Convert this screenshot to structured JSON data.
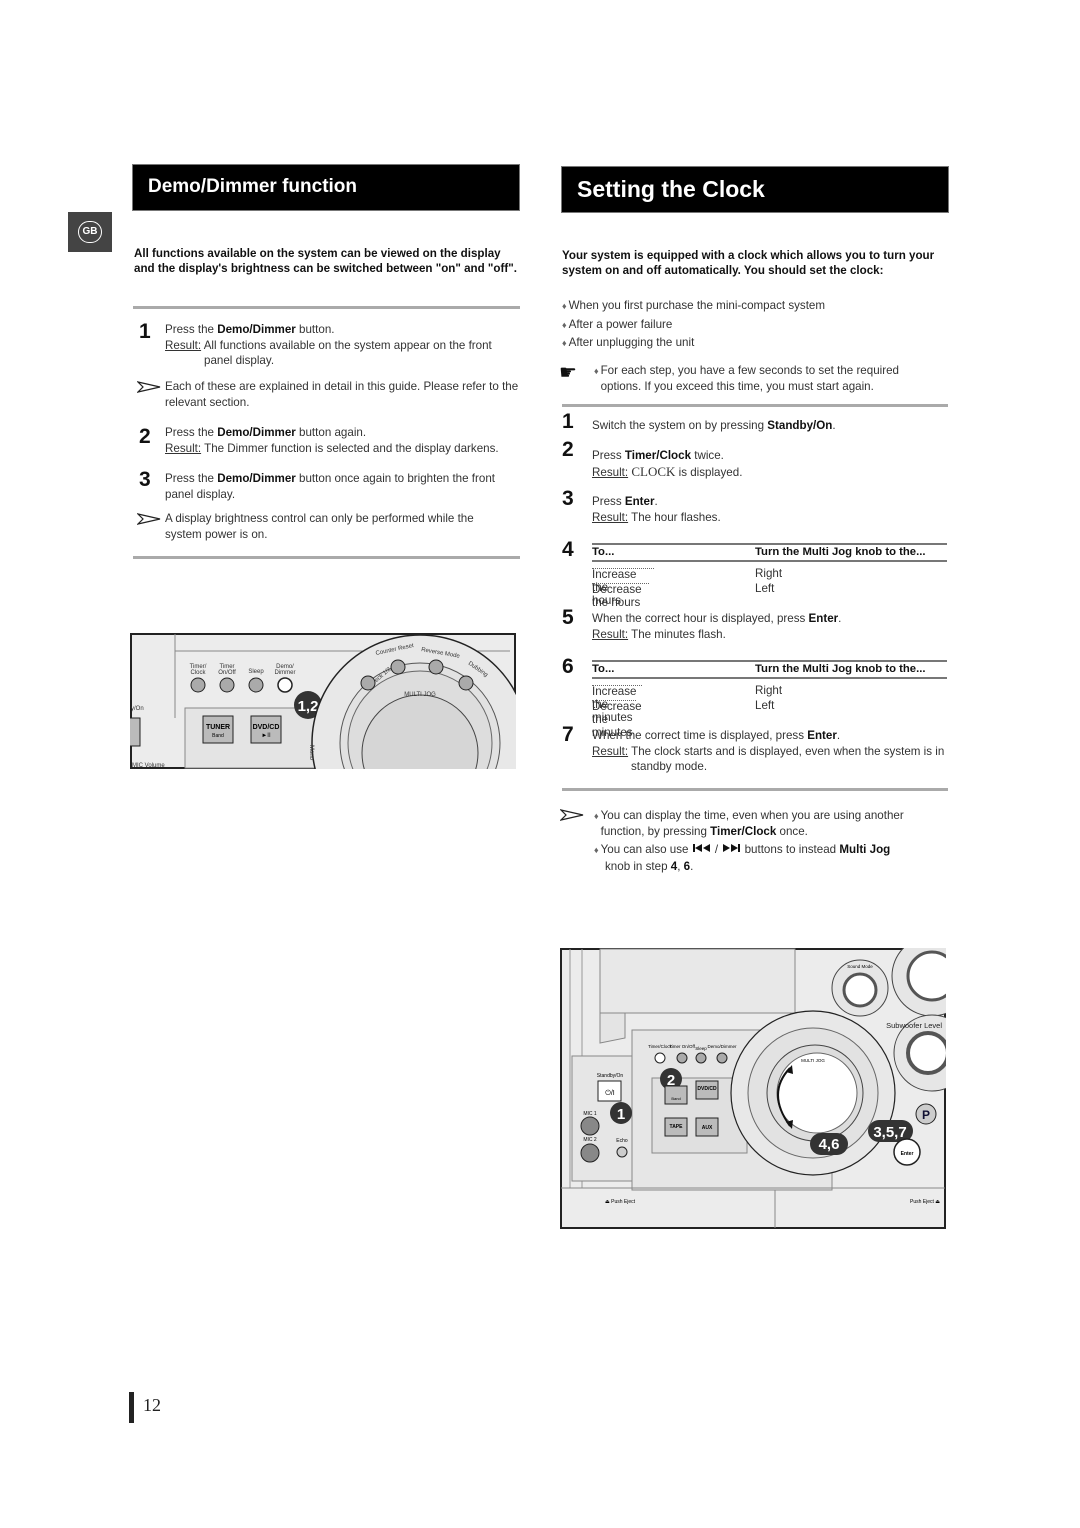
{
  "language_badge": "GB",
  "left": {
    "title": "Demo/Dimmer function",
    "intro": "All functions available on the system can be viewed on the display and the display's brightness can be switched between \"on\" and \"off\".",
    "steps": [
      {
        "num": "1",
        "pre": "Press the ",
        "bold": "Demo/Dimmer",
        "post": " button.",
        "result_label": "Result:",
        "result": "All functions available on the system appear on the front",
        "result_cont": "panel display."
      },
      {
        "num": "2",
        "pre": "Press the ",
        "bold": "Demo/Dimmer",
        "post": " button again.",
        "result_label": "Result:",
        "result": "The Dimmer function is selected and the display darkens."
      },
      {
        "num": "3",
        "pre": "Press the ",
        "bold": "Demo/Dimmer",
        "post": " button once again to brighten the front panel display."
      }
    ],
    "notes": [
      "Each of these are explained in detail in this guide. Please refer to the relevant section.",
      "A display brightness control can only be performed while the system power is on."
    ],
    "illustration": {
      "buttons": [
        "Timer/",
        "Clock",
        "Timer",
        "On/Off",
        "Sleep",
        "Demo/",
        "Dimmer"
      ],
      "ring": [
        "Deck 1/2",
        "Counter Reset",
        "Reverse Mode",
        "Dubbing"
      ],
      "multi_jog": "MULTI JOG",
      "tuner": "TUNER",
      "band": "Band",
      "dvdcd": "DVD/CD",
      "play_pause": "►II",
      "standby_fragment": "y/On",
      "mic_volume": "MIC Volume",
      "mono": "Mono",
      "callout": "1,2"
    }
  },
  "right": {
    "title": "Setting the Clock",
    "intro": "Your system is equipped with a clock which allows you to turn your system on and off automatically. You should set the clock:",
    "bullets": [
      "When you first purchase the mini-compact system",
      "After a power failure",
      "After unplugging the unit"
    ],
    "hand_note": "For each step, you have a few seconds to set the required options. If you exceed this time, you must start again.",
    "step1": {
      "num": "1",
      "pre": "Switch the system on by pressing ",
      "bold": "Standby/On",
      "post": "."
    },
    "step2": {
      "num": "2",
      "pre": "Press ",
      "bold": "Timer/Clock",
      "post": " twice.",
      "result_label": "Result:",
      "result_serif": "CLOCK",
      "result": " is displayed."
    },
    "step3": {
      "num": "3",
      "pre": "Press ",
      "bold": "Enter",
      "post": ".",
      "result_label": "Result:",
      "result": "The hour flashes."
    },
    "step4": {
      "num": "4",
      "col1": "To...",
      "col2": "Turn the Multi Jog knob to the...",
      "rows": [
        {
          "action": "Increase the hours",
          "dir": "Right"
        },
        {
          "action": "Decrease the hours",
          "dir": "Left"
        }
      ]
    },
    "step5": {
      "num": "5",
      "pre": "When the correct hour is displayed, press ",
      "bold": "Enter",
      "post": ".",
      "result_label": "Result:",
      "result": "The minutes flash."
    },
    "step6": {
      "num": "6",
      "col1": "To...",
      "col2": "Turn the Multi Jog knob to the...",
      "rows": [
        {
          "action": "Increase the minutes",
          "dir": "Right"
        },
        {
          "action": "Decrease the minutes",
          "dir": "Left"
        }
      ]
    },
    "step7": {
      "num": "7",
      "pre": "When the correct time is displayed, press ",
      "bold": "Enter",
      "post": ".",
      "result_label": "Result:",
      "result": "The clock starts and is displayed, even when the system is in",
      "result_cont": "standby mode."
    },
    "tips": [
      {
        "pre": "You can display the time, even when you are using another function, by pressing ",
        "bold": "Timer/Clock",
        "post": " once."
      },
      {
        "pre": "You can also use ",
        "sep": " / ",
        "mid": "  buttons to instead ",
        "bold": "Multi Jog",
        "post2": "knob in step ",
        "b4": "4",
        ",": ", ",
        "b6": "6",
        "end": "."
      }
    ],
    "illustration": {
      "standby": "Standby/On",
      "power_symbol": "⏻/I",
      "mic1": "MIC 1",
      "mic2": "MIC 2",
      "echo": "Echo",
      "buttons": [
        "Timer/Clock",
        "Timer On/Off",
        "Sleep",
        "Demo/Dimmer"
      ],
      "dvdcd": "DVD/CD",
      "band": "Band",
      "tape": "TAPE",
      "aux": "AUX",
      "multi_jog": "MULTI JOG",
      "enter": "Enter",
      "sound_mode": "Sound Mode",
      "subwoofer": "Subwoofer Level",
      "push_eject_left": "⏏ Push Eject",
      "push_eject_right": "Push Eject ⏏",
      "callouts": [
        "1",
        "2",
        "4,6",
        "3,5,7"
      ]
    }
  },
  "page_number": "12"
}
